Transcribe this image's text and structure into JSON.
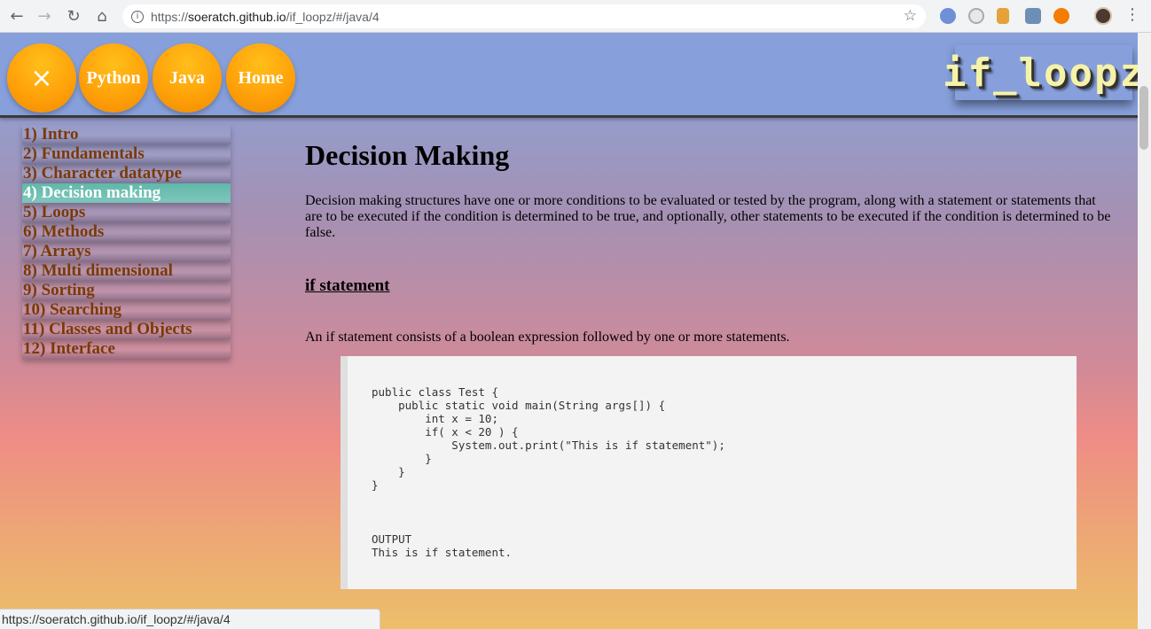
{
  "browser": {
    "url_scheme": "https://",
    "url_host": "soeratch.github.io",
    "url_path": "/if_loopz/#/java/4",
    "status_url": "https://soeratch.github.io/if_loopz/#/java/4"
  },
  "header": {
    "close_icon": "×",
    "nav": [
      "Python",
      "Java",
      "Home"
    ],
    "logo": "if_loopz"
  },
  "sidebar": {
    "items": [
      "1) Intro",
      "2) Fundamentals",
      "3) Character datatype",
      "4) Decision making",
      "5) Loops",
      "6) Methods",
      "7) Arrays",
      "8) Multi dimensional",
      "9) Sorting",
      "10) Searching",
      "11) Classes and Objects",
      "12) Interface"
    ],
    "active_index": 3
  },
  "main": {
    "title": "Decision Making",
    "intro": "Decision making structures have one or more conditions to be evaluated or tested by the program, along with a statement or statements that are to be executed if the condition is determined to be true, and optionally, other statements to be executed if the condition is determined to be false.",
    "section_title": "if statement",
    "section_desc": "An if statement consists of a boolean expression followed by one or more statements.",
    "code": "public class Test {\n    public static void main(String args[]) {\n        int x = 10;\n        if( x < 20 ) {\n            System.out.print(\"This is if statement\");\n        }\n    }\n}",
    "output_label": "OUTPUT",
    "output_text": "This is if statement."
  },
  "colors": {
    "header_bg": "#87a0dc",
    "blob": "#ffa20a",
    "sidebar_text": "#7a3a06",
    "active_item": "#5fb8a8",
    "logo_text": "#f6f3a8"
  }
}
